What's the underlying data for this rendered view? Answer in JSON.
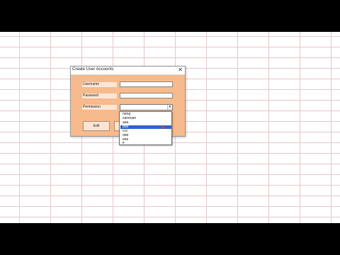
{
  "dialog": {
    "title": "Create User Accounts",
    "close_glyph": "✕",
    "labels": {
      "username": "Username",
      "password": "Password",
      "permission": "Permission"
    },
    "inputs": {
      "username_value": "",
      "password_value": "",
      "permission_value": ""
    },
    "combo_arrow": "▾",
    "buttons": {
      "edit": "Edit"
    }
  },
  "dropdown": {
    "options": [
      "heng",
      "samhath",
      "aaa",
      "bbb",
      "ccc",
      "ddd",
      "eee",
      "ff"
    ],
    "selected_index": 3
  },
  "colors": {
    "dialog_body": "#f6ba8c",
    "label_bg": "#fbe5d6",
    "selection": "#2f66c8",
    "grid": "#e6c9cd"
  }
}
